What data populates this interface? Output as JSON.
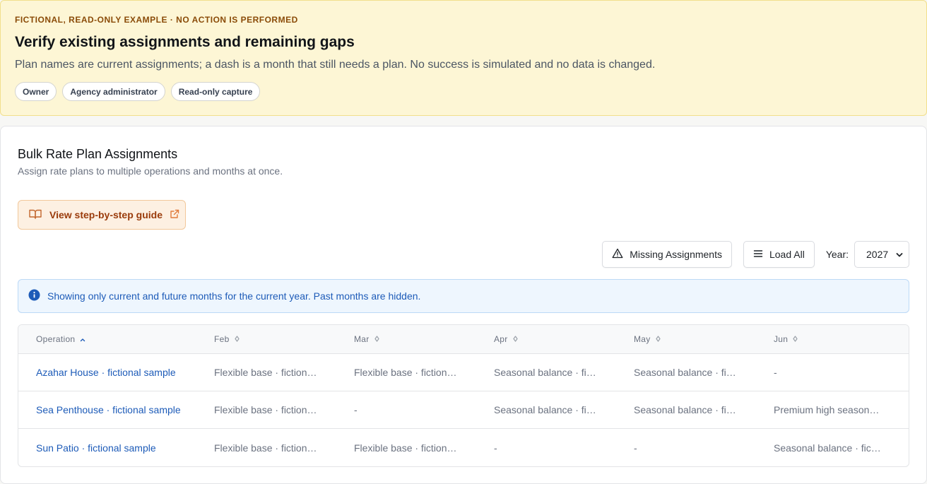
{
  "banner": {
    "eyebrow": "FICTIONAL, READ-ONLY EXAMPLE · NO ACTION IS PERFORMED",
    "title": "Verify existing assignments and remaining gaps",
    "description": "Plan names are current assignments; a dash is a month that still needs a plan. No success is simulated and no data is changed.",
    "chips": [
      "Owner",
      "Agency administrator",
      "Read-only capture"
    ]
  },
  "card": {
    "title": "Bulk Rate Plan Assignments",
    "subtitle": "Assign rate plans to multiple operations and months at once.",
    "guide_label": "View step-by-step guide"
  },
  "toolbar": {
    "missing_label": "Missing Assignments",
    "load_all_label": "Load All",
    "year_label": "Year:",
    "year_value": "2027"
  },
  "info": {
    "text": "Showing only current and future months for the current year. Past months are hidden."
  },
  "table": {
    "columns": [
      "Operation",
      "Feb",
      "Mar",
      "Apr",
      "May",
      "Jun"
    ],
    "rows": [
      {
        "operation": "Azahar House · fictional sample",
        "feb": "Flexible base · fictional sample",
        "mar": "Flexible base · fictional sample",
        "apr": "Seasonal balance · fictional sample",
        "may": "Seasonal balance · fictional sample",
        "jun": "-"
      },
      {
        "operation": "Sea Penthouse · fictional sample",
        "feb": "Flexible base · fictional sample",
        "mar": "-",
        "apr": "Seasonal balance · fictional sample",
        "may": "Seasonal balance · fictional sample",
        "jun": "Premium high season · fictional sample"
      },
      {
        "operation": "Sun Patio · fictional sample",
        "feb": "Flexible base · fictional sample",
        "mar": "Flexible base · fictional sample",
        "apr": "-",
        "may": "-",
        "jun": "Seasonal balance · fictional sample"
      }
    ]
  },
  "colors": {
    "banner_bg": "#fdf6d5",
    "eyebrow": "#8a4b08",
    "link_blue": "#1d5bb8",
    "guide_text": "#9a3b0b",
    "info_bg": "#eef6fe"
  },
  "icons": {
    "guide": "book-open-icon",
    "external": "external-link-icon",
    "missing": "warning-triangle-icon",
    "load_all": "list-icon",
    "info": "info-circle-icon",
    "sort_active": "chevron-up-icon",
    "sort": "sort-icon",
    "select": "chevron-down-icon"
  }
}
